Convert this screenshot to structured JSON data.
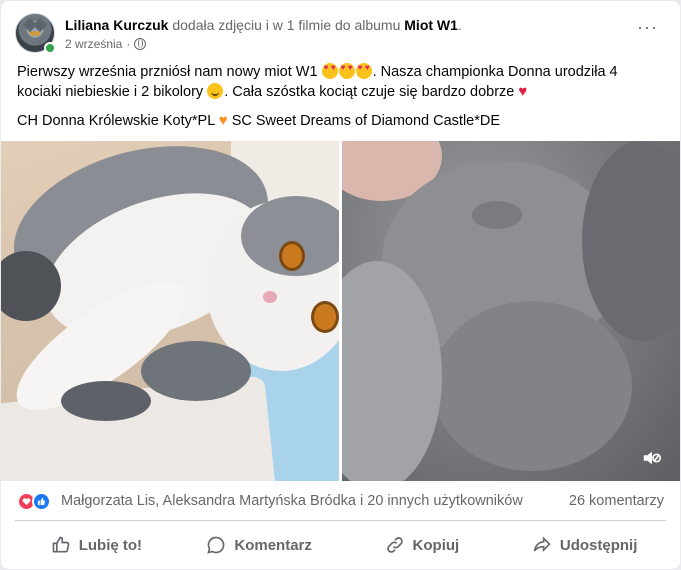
{
  "post": {
    "author": "Liliana Kurczuk",
    "action_text": "dodała zdjęciu i w 1 filmie do albumu",
    "album": "Miot W1",
    "album_suffix": ".",
    "date": "2 września",
    "date_separator": "·",
    "privacy_icon": "globe-icon",
    "more_icon": "more-options-icon",
    "more_label": "···",
    "text_line1_part1": "Pierwszy września przniósł nam nowy miot W1",
    "text_line1_part2": ". Nasza championka Donna urodziła 4 kociaki niebieskie i 2 bikolory",
    "text_line1_part3": ". Cała szóstka kociąt czuje się bardzo dobrze",
    "text_line2_part1": "CH Donna Królewskie Koty*PL",
    "text_line2_part2": "SC Sweet Dreams of Diamond Castle*DE",
    "emoji_heart_eyes": "smiling-face-with-heart-eyes",
    "emoji_smile": "slightly-smiling-face",
    "emoji_red_heart": "♥",
    "emoji_orange_heart": "♥"
  },
  "media": {
    "left_photo": "bicolor blue-white cat with kittens",
    "right_video": "gray kitten close-up video",
    "mute_icon": "muted-speaker-icon"
  },
  "stats": {
    "reaction_icons": [
      "love-reaction-icon",
      "like-reaction-icon"
    ],
    "reactors": "Małgorzata Lis, Aleksandra Martyńska Bródka i 20 innych użytkowników",
    "comments": "26 komentarzy"
  },
  "actions": {
    "like": "Lubię to!",
    "comment": "Komentarz",
    "copy": "Kopiuj",
    "share": "Udostępnij"
  },
  "colors": {
    "primary_text": "#050505",
    "secondary_text": "#65676b",
    "like_blue": "#1877f2",
    "love_red": "#f33e58",
    "online_green": "#31a24c",
    "divider": "#ced0d4"
  }
}
